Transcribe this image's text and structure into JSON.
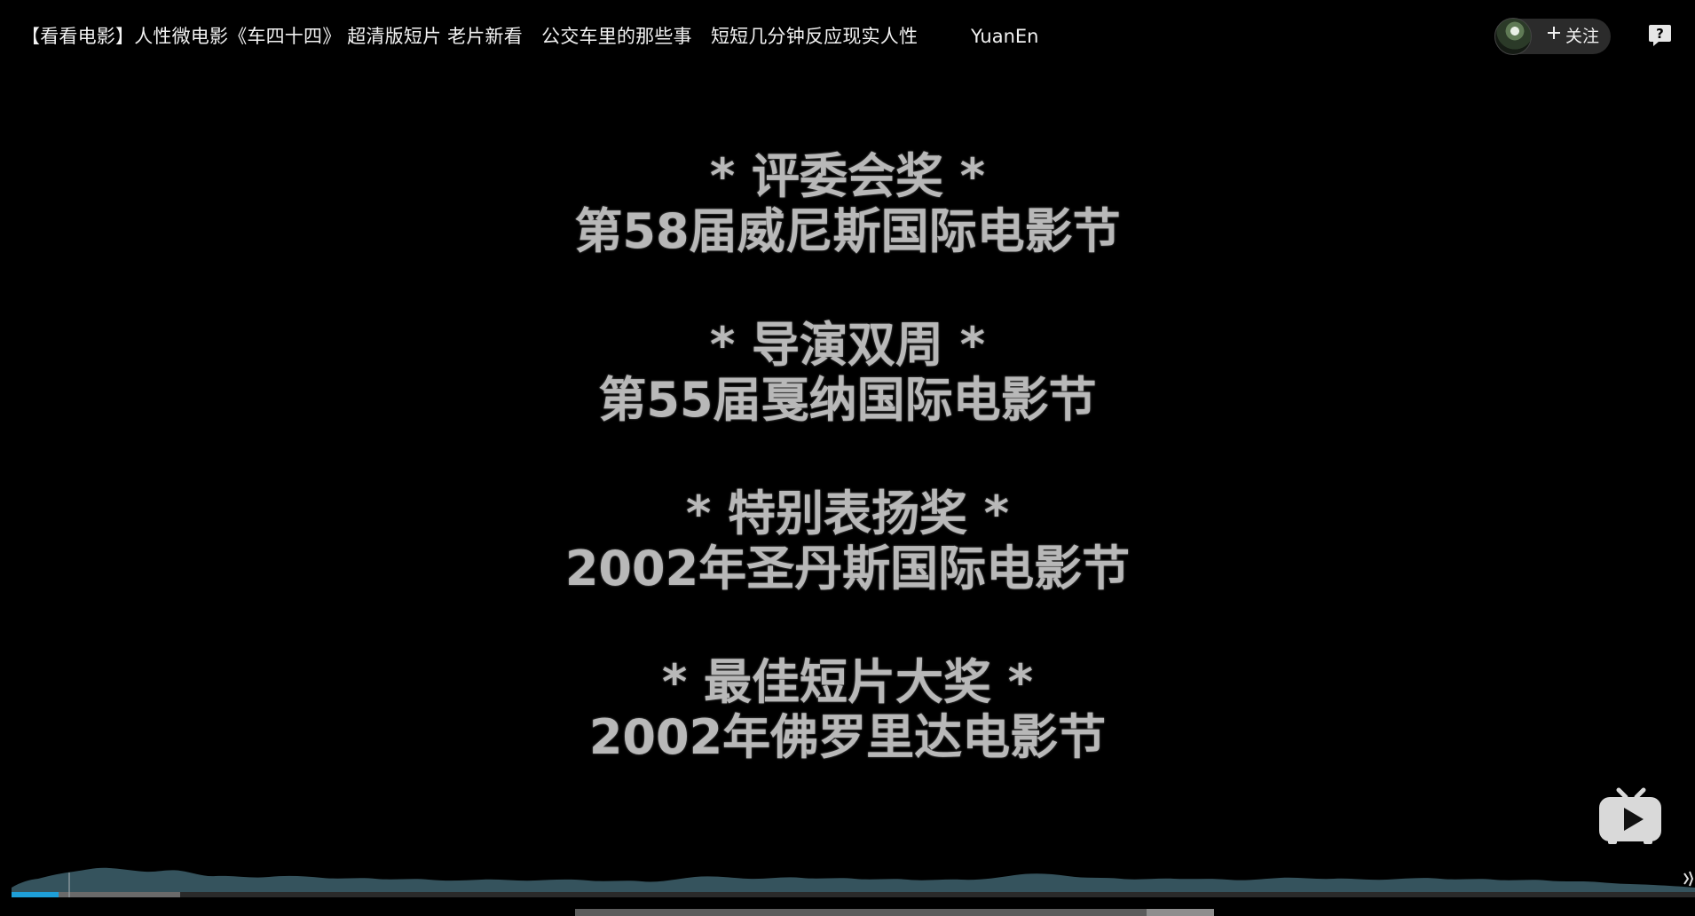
{
  "header": {
    "video_title": "【看看电影】人性微电影《车四十四》 超清版短片 老片新看　公交车里的那些事　短短几分钟反应现实人性",
    "uploader_name": "YuanEn",
    "follow_label": "关注",
    "follow_icon": "plus-icon",
    "help_icon": "question-icon"
  },
  "video": {
    "awards": [
      {
        "prize": "* 评委会奖 *",
        "festival": "第58届威尼斯国际电影节"
      },
      {
        "prize": "* 导演双周 *",
        "festival": "第55届戛纳国际电影节"
      },
      {
        "prize": "* 特别表扬奖 *",
        "festival": "2002年圣丹斯国际电影节"
      },
      {
        "prize": "* 最佳短片大奖 *",
        "festival": "2002年佛罗里达电影节"
      }
    ],
    "logo_icon": "tv-play-icon"
  },
  "player": {
    "played_fraction": 0.028,
    "buffered_fraction": 0.1,
    "accent_color": "#1e9fd8",
    "waveform_color": "#35535d"
  },
  "page_scrollbar": {
    "thumb_fraction": 0.106
  }
}
